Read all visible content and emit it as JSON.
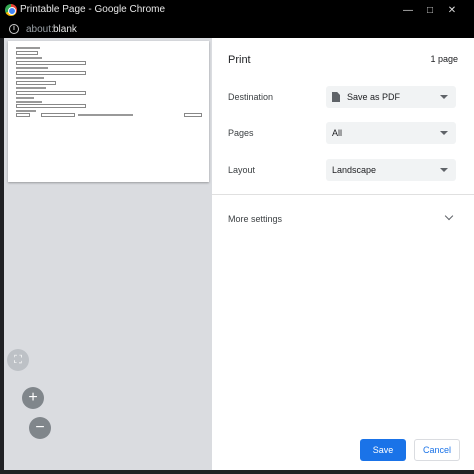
{
  "window": {
    "title": "Printable Page - Google Chrome",
    "minimize_icon": "minimize-icon",
    "maximize_icon": "maximize-icon",
    "close_icon": "close-icon",
    "minimize_glyph": "—",
    "maximize_glyph": "□",
    "close_glyph": "✕"
  },
  "address_bar": {
    "scheme": "about:",
    "host": "blank",
    "info_glyph": "i"
  },
  "preview": {
    "fit_glyph": "⛶",
    "zoom_in_glyph": "+",
    "zoom_out_glyph": "−"
  },
  "print_panel": {
    "title": "Print",
    "page_count": "1 page",
    "destination": {
      "label": "Destination",
      "value": "Save as PDF"
    },
    "pages": {
      "label": "Pages",
      "value": "All"
    },
    "layout": {
      "label": "Layout",
      "value": "Landscape"
    },
    "more_settings": "More settings",
    "save_label": "Save",
    "cancel_label": "Cancel"
  },
  "colors": {
    "accent": "#1a73e8",
    "titlebar": "#000000",
    "preview_bg": "#dadce0",
    "select_bg": "#f1f3f4"
  }
}
